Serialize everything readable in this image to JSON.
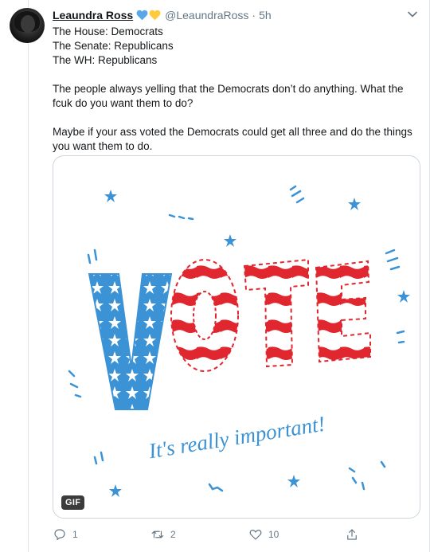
{
  "tweet": {
    "display_name": "Leaundra Ross",
    "handle": "@LeaundraRoss",
    "separator": "·",
    "time": "5h",
    "lines": [
      "The House: Democrats",
      "The Senate: Republicans",
      "The WH: Republicans"
    ],
    "paragraph1": "The people always yelling that the Democrats don’t do anything.  What the fcuk do you want them to do?",
    "paragraph2": "Maybe if your ass voted the Democrats could get all three and do the things you want them to do.",
    "emoji": [
      "blue-heart-icon",
      "yellow-heart-icon"
    ]
  },
  "media": {
    "gif_label": "GIF",
    "vote_letters": [
      "V",
      "O",
      "T",
      "E"
    ],
    "caption": "It's really important!"
  },
  "actions": {
    "replies": "1",
    "retweets": "2",
    "likes": "10"
  },
  "colors": {
    "blue": "#3b93d6",
    "red": "#e0262e",
    "text": "#14171a",
    "muted": "#657786",
    "heart_blue": "#5aa6e8",
    "heart_yellow": "#ffcb3d"
  }
}
